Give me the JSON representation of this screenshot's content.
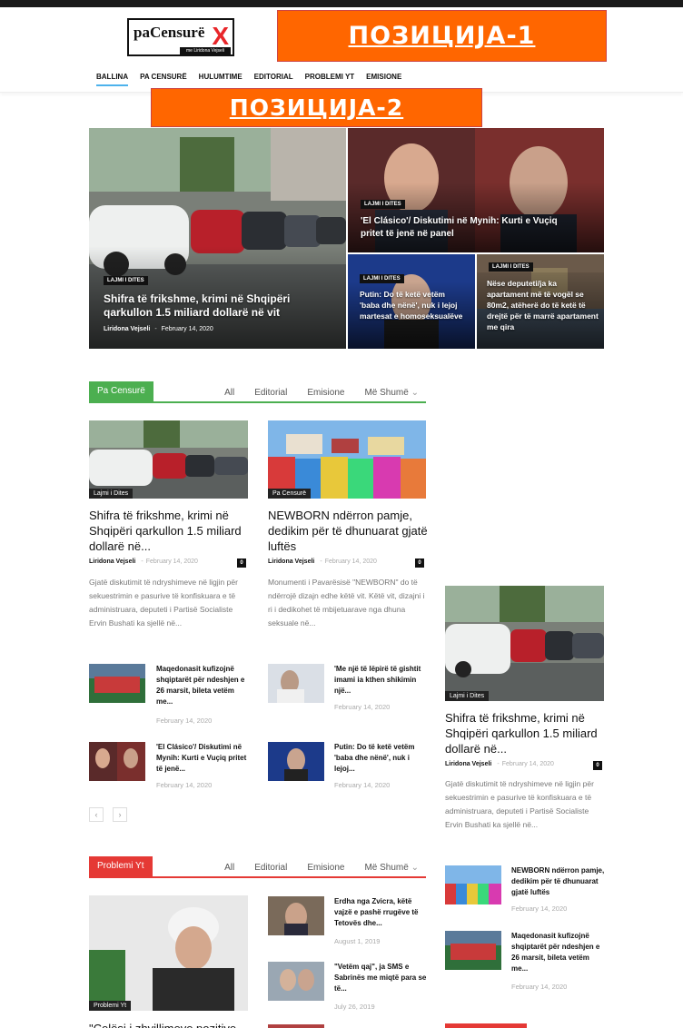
{
  "header": {
    "logo_text": "paCensurë",
    "logo_x": "X",
    "logo_sub": "me Liridona Vejseli",
    "ad1": "ПОЗИЦИЈА-1",
    "ad2": "ПОЗИЦИЈА-2"
  },
  "nav": [
    "BALLINA",
    "PA CENSURË",
    "HULUMTIME",
    "EDITORIAL",
    "PROBLEMI YT",
    "EMISIONE"
  ],
  "featured": {
    "main": {
      "category": "LAJMI I DITES",
      "title": "Shifra të frikshme, krimi në Shqipëri qarkullon 1.5 miliard dollarë në vit",
      "author": "Liridona Vejseli",
      "separator": "-",
      "date": "February 14, 2020"
    },
    "top_right": {
      "category": "LAJMI I DITES",
      "title": "'El Clásico'/ Diskutimi në Mynih: Kurti e Vuçiq pritet të jenë në panel"
    },
    "bottom_mid": {
      "category": "LAJMI I DITES",
      "title": "Putin: Do të ketë vetëm 'baba dhe nënë', nuk i lejoj martesat e homoseksualëve"
    },
    "bottom_right": {
      "category": "LAJMI I DITES",
      "title": "Nëse deputeti/ja ka apartament më të vogël se 80m2, atëherë do të ketë të drejtë për të marrë apartament me qira"
    }
  },
  "section1": {
    "label": "Pa Censurë",
    "tabs": [
      "All",
      "Editorial",
      "Emisione",
      "Më Shumë"
    ],
    "cards": [
      {
        "category": "Lajmi i Dites",
        "title": "Shifra të frikshme, krimi në Shqipëri qarkullon 1.5 miliard dollarë në...",
        "author": "Liridona Vejseli",
        "separator": "-",
        "date": "February 14, 2020",
        "comments": "0",
        "excerpt": "Gjatë diskutimit të ndryshimeve në ligjin për sekuestrimin e pasurive të konfiskuara e të administruara, deputeti i Partisë Socialiste Ervin Bushati ka sjellë në..."
      },
      {
        "category": "Pa Censurë",
        "title": "NEWBORN ndërron pamje, dedikim për të dhunuarat gjatë luftës",
        "author": "Liridona Vejseli",
        "separator": "-",
        "date": "February 14, 2020",
        "comments": "0",
        "excerpt": "Monumenti i Pavarësisë \"NEWBORN\" do të ndërrojë dizajn edhe këtë vit. Këtë vit, dizajni i ri i dedikohet të mbijetuarave nga dhuna seksuale në..."
      }
    ],
    "small": [
      {
        "title": "Maqedonasit kufizojnë shqiptarët për ndeshjen e 26 marsit, bileta vetëm me...",
        "date": "February 14, 2020"
      },
      {
        "title": "'Me një të lëpirë të gishtit imami ia kthen shikimin një...",
        "date": "February 14, 2020"
      },
      {
        "title": "'El Clásico'/ Diskutimi në Mynih: Kurti e Vuçiq pritet të jenë...",
        "date": "February 14, 2020"
      },
      {
        "title": "Putin: Do të ketë vetëm 'baba dhe nënë', nuk i lejoj...",
        "date": "February 14, 2020"
      }
    ],
    "pager_prev": "‹",
    "pager_next": "›"
  },
  "section2": {
    "label": "Problemi Yt",
    "tabs": [
      "All",
      "Editorial",
      "Emisione",
      "Më Shumë"
    ],
    "main": {
      "category": "Problemi Yt",
      "title": "\"Celësi i zhvillimeve pozitive"
    },
    "small": [
      {
        "title": "Erdha nga Zvicra, këtë vajzë e pashë rrugëve të Tetovës dhe...",
        "date": "August 1, 2019"
      },
      {
        "title": "\"Vetëm qaj\", ja SMS e Sabrinës me miqtë para se të...",
        "date": "July 26, 2019"
      }
    ]
  },
  "sidebar": {
    "card": {
      "category": "Lajmi i Dites",
      "title": "Shifra të frikshme, krimi në Shqipëri qarkullon 1.5 miliard dollarë në...",
      "author": "Liridona Vejseli",
      "separator": "-",
      "date": "February 14, 2020",
      "comments": "0",
      "excerpt": "Gjatë diskutimit të ndryshimeve në ligjin për sekuestrimin e pasurive të konfiskuara e të administruara, deputeti i Partisë Socialiste Ervin Bushati ka sjellë në..."
    },
    "small": [
      {
        "title": "NEWBORN ndërron pamje, dedikim për të dhunuarat gjatë luftës",
        "date": "February 14, 2020"
      },
      {
        "title": "Maqedonasit kufizojnë shqiptarët për ndeshjen e 26 marsit, bileta vetëm me...",
        "date": "February 14, 2020"
      }
    ]
  },
  "colors": {
    "accent_blue": "#4db2ec",
    "section_green": "#4caf50",
    "section_red": "#e53935",
    "ad_orange": "#ff6600"
  }
}
